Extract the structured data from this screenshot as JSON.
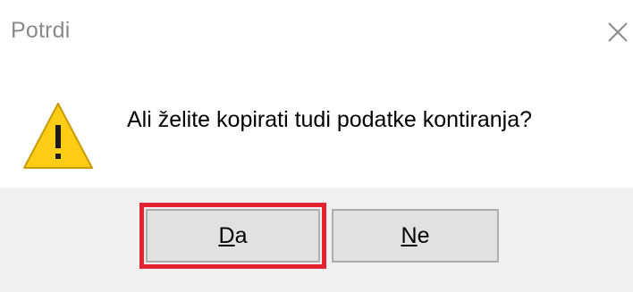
{
  "dialog": {
    "title": "Potrdi",
    "message": "Ali želite kopirati tudi podatke kontiranja?",
    "icon": "warning-icon",
    "close_icon": "close-icon"
  },
  "buttons": {
    "yes": {
      "mnemonic": "D",
      "rest": "a"
    },
    "no": {
      "mnemonic": "N",
      "rest": "e"
    }
  },
  "highlight_color": "#e3232f"
}
